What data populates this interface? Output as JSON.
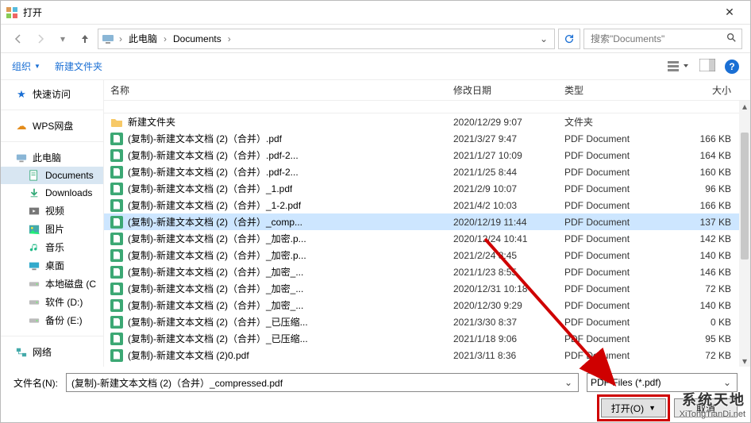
{
  "window": {
    "title": "打开"
  },
  "nav": {
    "breadcrumb": [
      "此电脑",
      "Documents"
    ],
    "search_placeholder": "搜索\"Documents\""
  },
  "toolbar": {
    "organize": "组织",
    "new_folder": "新建文件夹"
  },
  "sidebar": {
    "quick": {
      "label": "快速访问"
    },
    "wps": {
      "label": "WPS网盘"
    },
    "thispc": {
      "label": "此电脑"
    },
    "thispc_children": [
      {
        "id": "documents",
        "label": "Documents",
        "icon": "doc",
        "selected": true
      },
      {
        "id": "downloads",
        "label": "Downloads",
        "icon": "down"
      },
      {
        "id": "videos",
        "label": "视频",
        "icon": "video"
      },
      {
        "id": "pictures",
        "label": "图片",
        "icon": "pic"
      },
      {
        "id": "music",
        "label": "音乐",
        "icon": "music"
      },
      {
        "id": "desktop",
        "label": "桌面",
        "icon": "desk"
      },
      {
        "id": "diskc",
        "label": "本地磁盘 (C",
        "icon": "disk"
      },
      {
        "id": "diskd",
        "label": "软件 (D:)",
        "icon": "disk"
      },
      {
        "id": "diske",
        "label": "备份 (E:)",
        "icon": "disk"
      }
    ],
    "network": {
      "label": "网络"
    }
  },
  "columns": {
    "name": "名称",
    "date": "修改日期",
    "type": "类型",
    "size": "大小"
  },
  "files": [
    {
      "kind": "cut",
      "name": "",
      "date": "",
      "type": "",
      "size": ""
    },
    {
      "kind": "folder",
      "name": "新建文件夹",
      "date": "2020/12/29 9:07",
      "type": "文件夹",
      "size": ""
    },
    {
      "kind": "pdf",
      "name": "(复制)-新建文本文档 (2)（合并）.pdf",
      "date": "2021/3/27 9:47",
      "type": "PDF Document",
      "size": "166 KB"
    },
    {
      "kind": "pdf",
      "name": "(复制)-新建文本文档 (2)（合并）.pdf-2...",
      "date": "2021/1/27 10:09",
      "type": "PDF Document",
      "size": "164 KB"
    },
    {
      "kind": "pdf",
      "name": "(复制)-新建文本文档 (2)（合并）.pdf-2...",
      "date": "2021/1/25 8:44",
      "type": "PDF Document",
      "size": "160 KB"
    },
    {
      "kind": "pdf",
      "name": "(复制)-新建文本文档 (2)（合并）_1.pdf",
      "date": "2021/2/9 10:07",
      "type": "PDF Document",
      "size": "96 KB"
    },
    {
      "kind": "pdf",
      "name": "(复制)-新建文本文档 (2)（合并）_1-2.pdf",
      "date": "2021/4/2 10:03",
      "type": "PDF Document",
      "size": "166 KB"
    },
    {
      "kind": "pdf",
      "selected": true,
      "name": "(复制)-新建文本文档 (2)（合并）_comp...",
      "date": "2020/12/19 11:44",
      "type": "PDF Document",
      "size": "137 KB"
    },
    {
      "kind": "pdf",
      "name": "(复制)-新建文本文档 (2)（合并）_加密.p...",
      "date": "2020/12/24 10:41",
      "type": "PDF Document",
      "size": "142 KB"
    },
    {
      "kind": "pdf",
      "name": "(复制)-新建文本文档 (2)（合并）_加密.p...",
      "date": "2021/2/24 8:45",
      "type": "PDF Document",
      "size": "140 KB"
    },
    {
      "kind": "pdf",
      "name": "(复制)-新建文本文档 (2)（合并）_加密_...",
      "date": "2021/1/23 8:55",
      "type": "PDF Document",
      "size": "146 KB"
    },
    {
      "kind": "pdf",
      "name": "(复制)-新建文本文档 (2)（合并）_加密_...",
      "date": "2020/12/31 10:18",
      "type": "PDF Document",
      "size": "72 KB"
    },
    {
      "kind": "pdf",
      "name": "(复制)-新建文本文档 (2)（合并）_加密_...",
      "date": "2020/12/30 9:29",
      "type": "PDF Document",
      "size": "140 KB"
    },
    {
      "kind": "pdf",
      "name": "(复制)-新建文本文档 (2)（合并）_已压缩...",
      "date": "2021/3/30 8:37",
      "type": "PDF Document",
      "size": "0 KB"
    },
    {
      "kind": "pdf",
      "name": "(复制)-新建文本文档 (2)（合并）_已压缩...",
      "date": "2021/1/18 9:06",
      "type": "PDF Document",
      "size": "95 KB"
    },
    {
      "kind": "pdf",
      "name": "(复制)-新建文本文档 (2)0.pdf",
      "date": "2021/3/11 8:36",
      "type": "PDF Document",
      "size": "72 KB"
    }
  ],
  "footer": {
    "filename_label": "文件名(N):",
    "filename_value": "(复制)-新建文本文档 (2)（合并）_compressed.pdf",
    "filter": "PDF Files (*.pdf)",
    "open": "打开(O)",
    "cancel": "取消"
  },
  "watermark": {
    "cn": "系统天地",
    "en": "XiTongTianDi.net"
  }
}
